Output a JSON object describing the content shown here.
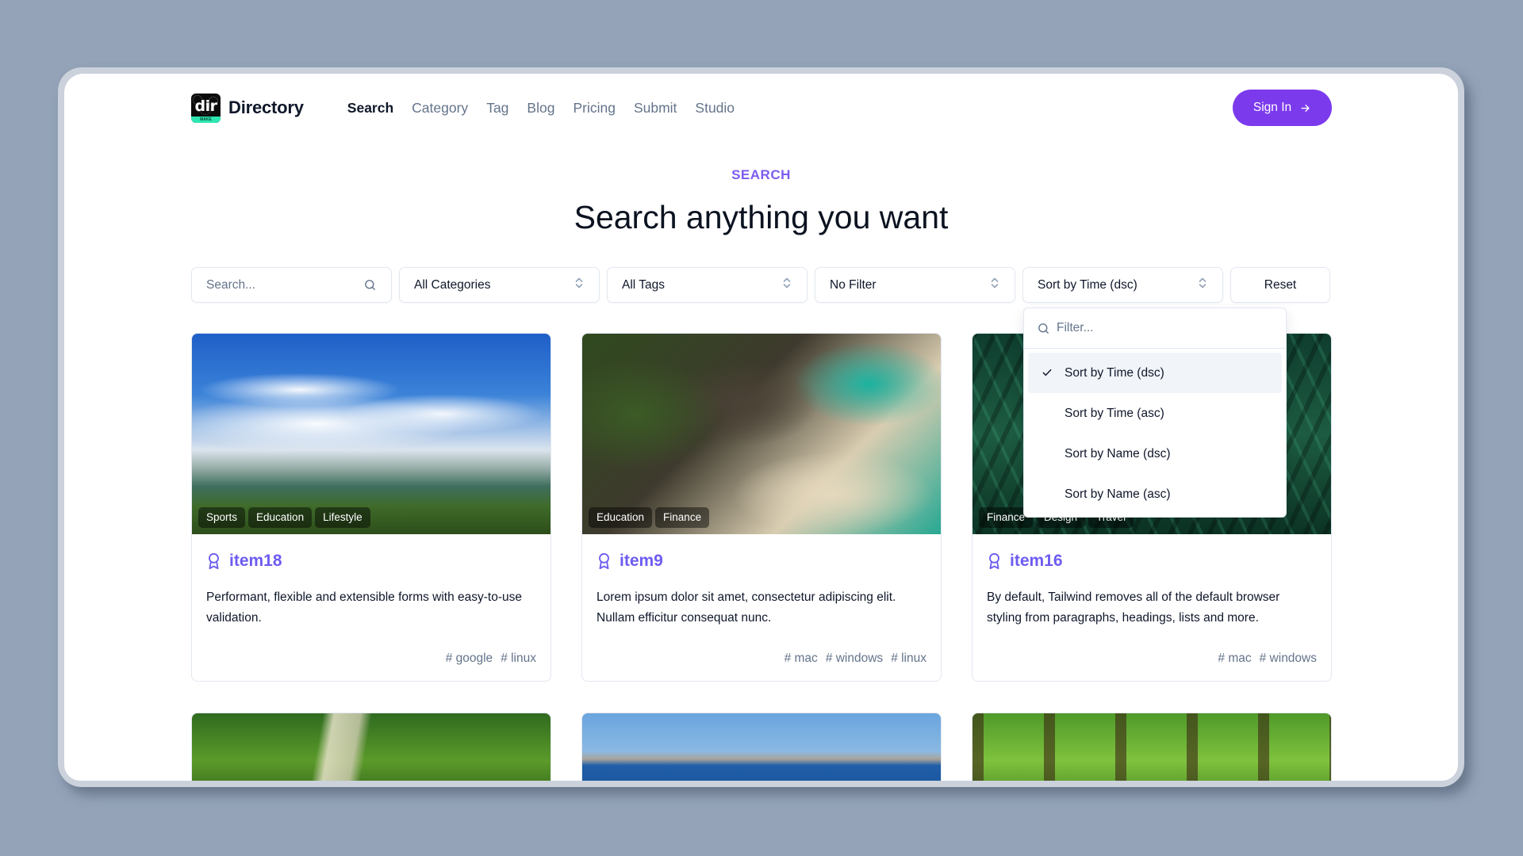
{
  "header": {
    "logo_mark_text": "dir",
    "logo_mark_sub": "MAKE",
    "app_name": "Directory",
    "nav": [
      {
        "label": "Search",
        "active": true
      },
      {
        "label": "Category",
        "active": false
      },
      {
        "label": "Tag",
        "active": false
      },
      {
        "label": "Blog",
        "active": false
      },
      {
        "label": "Pricing",
        "active": false
      },
      {
        "label": "Submit",
        "active": false
      },
      {
        "label": "Studio",
        "active": false
      }
    ],
    "signin_label": "Sign In"
  },
  "hero": {
    "eyebrow": "SEARCH",
    "title": "Search anything you want"
  },
  "filters": {
    "search_placeholder": "Search...",
    "search_value": "",
    "category_select": "All Categories",
    "tag_select": "All Tags",
    "filter_select": "No Filter",
    "sort_select": "Sort by Time (dsc)",
    "reset_label": "Reset"
  },
  "sort_dropdown": {
    "open": true,
    "filter_placeholder": "Filter...",
    "options": [
      {
        "label": "Sort by Time (dsc)",
        "selected": true
      },
      {
        "label": "Sort by Time (asc)",
        "selected": false
      },
      {
        "label": "Sort by Name (dsc)",
        "selected": false
      },
      {
        "label": "Sort by Name (asc)",
        "selected": false
      }
    ]
  },
  "items": [
    {
      "name": "item18",
      "categories": [
        "Sports",
        "Education",
        "Lifestyle"
      ],
      "description": "Performant, flexible and extensible forms with easy-to-use validation.",
      "tags": [
        "# google",
        "# linux"
      ]
    },
    {
      "name": "item9",
      "categories": [
        "Education",
        "Finance"
      ],
      "description": "Lorem ipsum dolor sit amet, consectetur adipiscing elit. Nullam efficitur consequat nunc.",
      "tags": [
        "# mac",
        "# windows",
        "# linux"
      ]
    },
    {
      "name": "item16",
      "categories": [
        "Finance",
        "Design",
        "Travel"
      ],
      "description": "By default, Tailwind removes all of the default browser styling from paragraphs, headings, lists and more.",
      "tags": [
        "# mac",
        "# windows"
      ]
    }
  ],
  "colors": {
    "accent": "#7c3aed",
    "item_title": "#6d5cf0",
    "background": "#94a3b8"
  }
}
